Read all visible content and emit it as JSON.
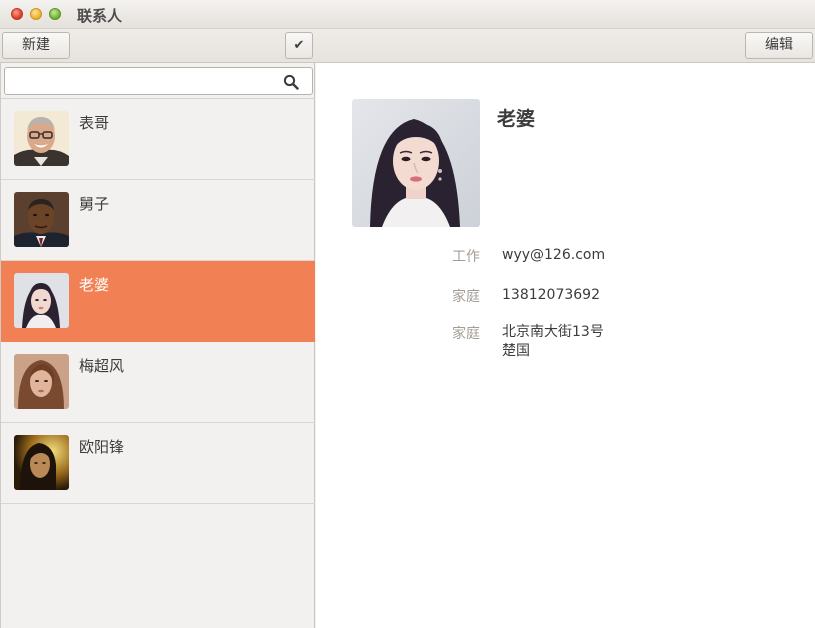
{
  "window": {
    "title": "联系人"
  },
  "toolbar": {
    "new_label": "新建",
    "check_label": "✔",
    "edit_label": "编辑"
  },
  "search": {
    "value": "",
    "placeholder": ""
  },
  "contacts": [
    {
      "name": "表哥",
      "selected": false
    },
    {
      "name": "舅子",
      "selected": false
    },
    {
      "name": "老婆",
      "selected": true
    },
    {
      "name": "梅超风",
      "selected": false
    },
    {
      "name": "欧阳锋",
      "selected": false
    }
  ],
  "detail": {
    "name": "老婆",
    "fields": [
      {
        "label": "工作",
        "value": "wyy@126.com"
      },
      {
        "label": "家庭",
        "value": "13812073692"
      },
      {
        "label": "家庭",
        "lines": [
          "北京南大街13号",
          "楚国"
        ]
      }
    ]
  },
  "colors": {
    "selection": "#f18154",
    "label": "#a49c94"
  }
}
